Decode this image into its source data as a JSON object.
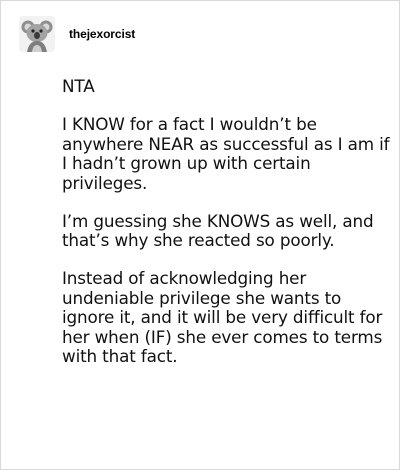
{
  "post": {
    "username": "thejexorcist",
    "avatar_icon": "koala-avatar-icon",
    "paragraphs": [
      "NTA",
      "I KNOW for a fact I wouldn’t be anywhere NEAR as successful as I am if I hadn’t grown up with certain privileges.",
      "I’m guessing she KNOWS as well, and that’s why she reacted so poorly.",
      "Instead of acknowledging her undeniable privilege she wants to ignore it, and it will be very difficult for her when (IF) she ever comes to terms with that fact."
    ]
  },
  "colors": {
    "border": "#d9d9d9",
    "text": "#111111",
    "background": "#ffffff"
  }
}
